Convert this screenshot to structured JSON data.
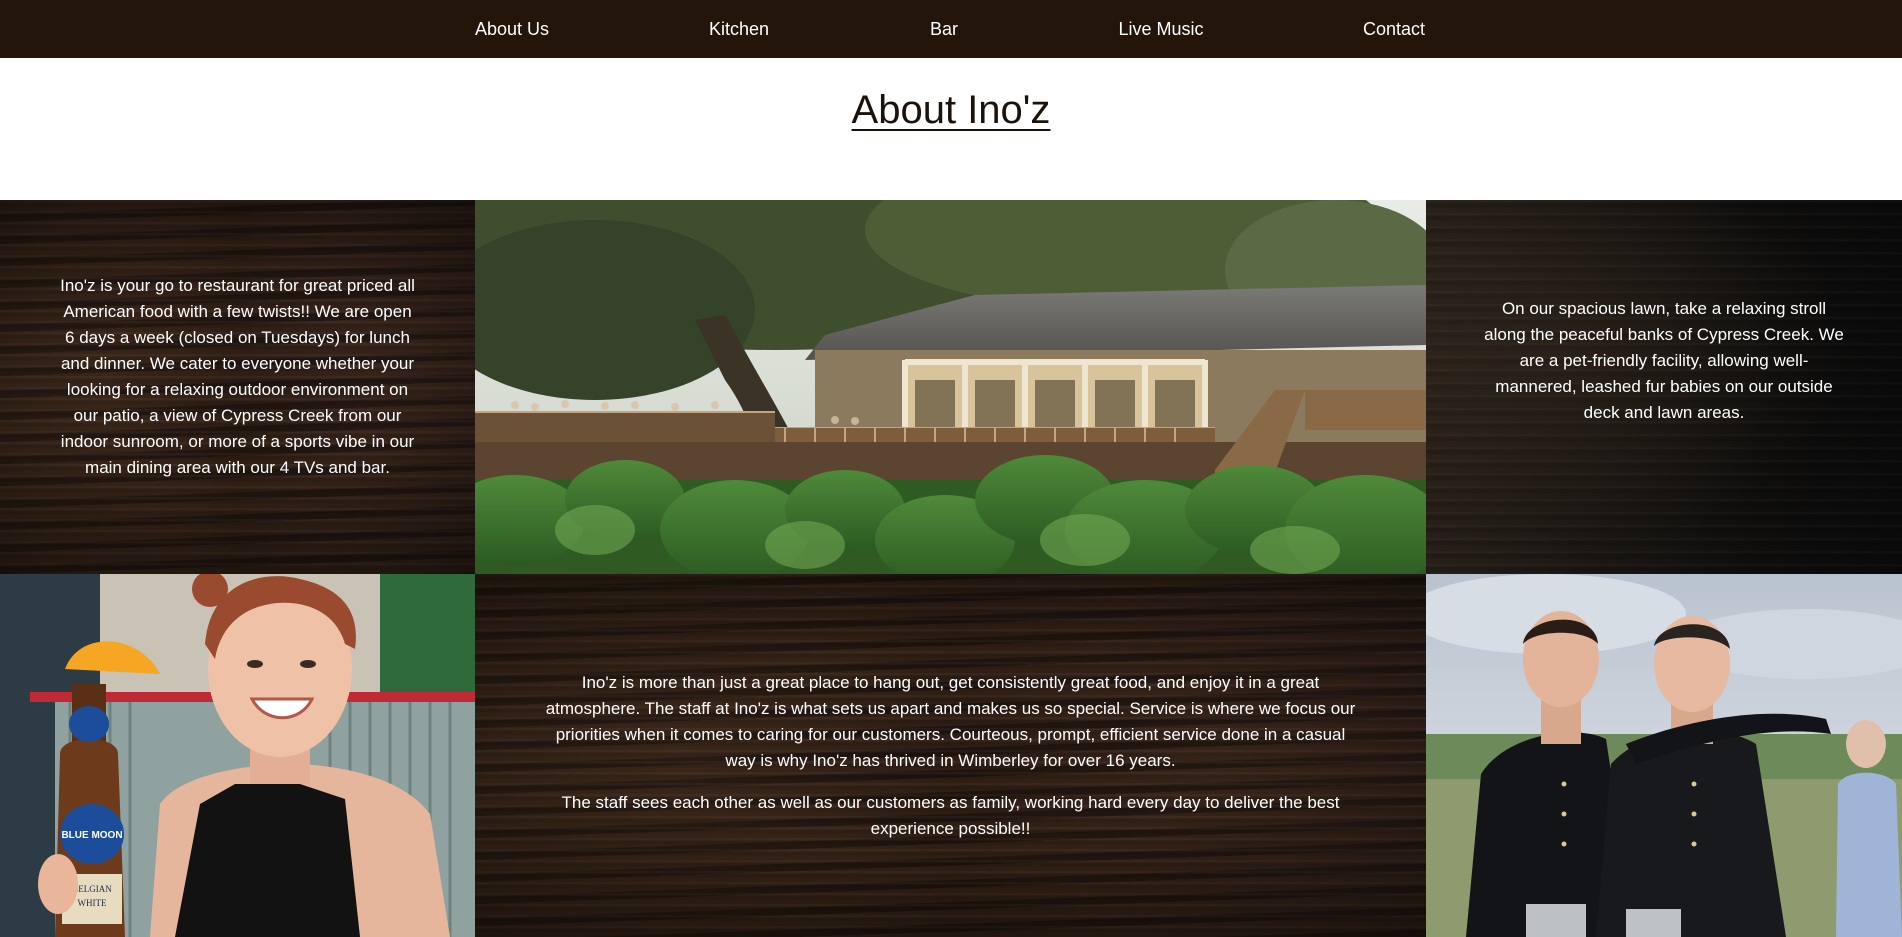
{
  "nav": {
    "items": [
      {
        "label": "About Us"
      },
      {
        "label": "Kitchen"
      },
      {
        "label": "Bar"
      },
      {
        "label": "Live Music"
      },
      {
        "label": "Contact"
      }
    ]
  },
  "page": {
    "title": "About Ino'z"
  },
  "panels": {
    "left_text": "Ino'z is your go to restaurant for great priced all American food with a few twists!! We are open 6 days a week (closed on Tuesdays) for lunch and dinner. We cater to everyone whether your looking for a relaxing outdoor environment on our patio, a view of Cypress Creek from our indoor sunroom, or more of a sports vibe in our main dining area with our 4 TVs and bar.",
    "right_text": "On our spacious lawn, take a relaxing stroll along the peaceful banks of Cypress Creek. We are a pet-friendly facility, allowing well-mannered, leashed fur babies on our outside deck and lawn areas.",
    "middle_text_1": "Ino'z is more than just a great place to hang out, get consistently great food, and enjoy it in a great atmosphere. The staff at Ino'z is what sets us apart and makes us so special. Service is where we focus our priorities when it comes to caring for our customers. Courteous, prompt, efficient service done in a casual way is why Ino'z has thrived in Wimberley for over 16 years.",
    "middle_text_2": "The staff sees each other as well as our customers as family, working hard every day to deliver the best experience possible!!"
  },
  "images": {
    "beer_label_1": "BLUE MOON",
    "beer_label_2": "BELGIAN",
    "beer_label_3": "WHITE"
  },
  "colors": {
    "nav_bg": "#231509",
    "nav_text": "#ffffff",
    "title_text": "#1a120b"
  }
}
